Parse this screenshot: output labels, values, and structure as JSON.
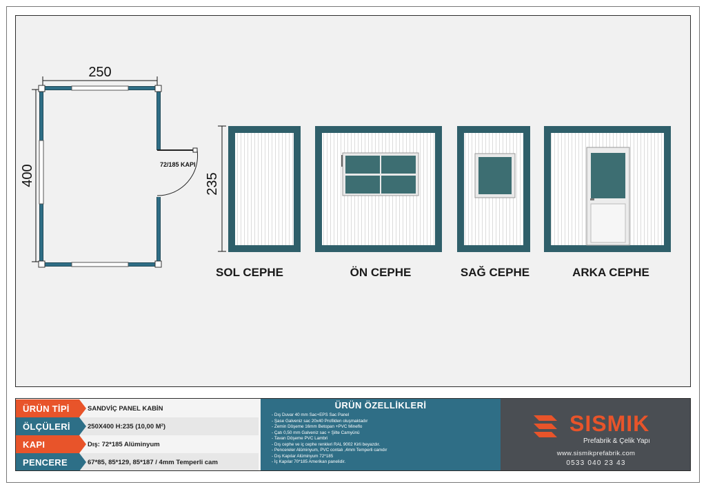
{
  "plan": {
    "width_label": "250",
    "depth_label": "400",
    "door_label": "72/185 KAPI"
  },
  "elevations": {
    "height_label": "235",
    "sol": "SOL CEPHE",
    "on": "ÖN CEPHE",
    "sag": "SAĞ CEPHE",
    "arka": "ARKA CEPHE"
  },
  "info": {
    "rows": [
      {
        "tag": "ÜRÜN TİPİ",
        "value": "SANDVİÇ PANEL KABİN"
      },
      {
        "tag": "ÖLÇÜLERİ",
        "value": "250X400 H:235 (10,00 M²)"
      },
      {
        "tag": "KAPI",
        "value": "Dış: 72*185 Alüminyum"
      },
      {
        "tag": "PENCERE",
        "value": "67*85, 85*129, 85*187 / 4mm Temperli cam"
      }
    ],
    "specs_title": "ÜRÜN ÖZELLİKLERİ",
    "specs": [
      "- Dış Duvar 40 mm Sac+EPS Sac Panel",
      "- Şase Galveniz sac 20x40 Profilden oluşmaktadır",
      "- Zemin Döşeme 16mm Betopan +PVC Mineflo",
      "- Çatı 0,50 mm Galveniz sac + Şilte Camyünü",
      "- Tavan Döşeme PVC Lambri",
      "- Dış cephe ve iç cephe renkleri RAL 9002 Kirli beyazdır.",
      "- Pencereler Alüminyum, PVC contalı ,4mm Temperli camdır",
      "- Dış Kapılar Alüminyum 72*185",
      "- İç Kapılar 70*185 Amerikan panelidir."
    ],
    "brand": "SISMIK",
    "brand_sub": "Prefabrik & Çelik Yapı",
    "web": "www.sismikprefabrik.com",
    "phone": "0533 040 23 43"
  },
  "colors": {
    "frame_teal": "#2f5f6a",
    "glass": "#3d6e72",
    "orange": "#e8542a",
    "blue": "#2d6f87"
  }
}
